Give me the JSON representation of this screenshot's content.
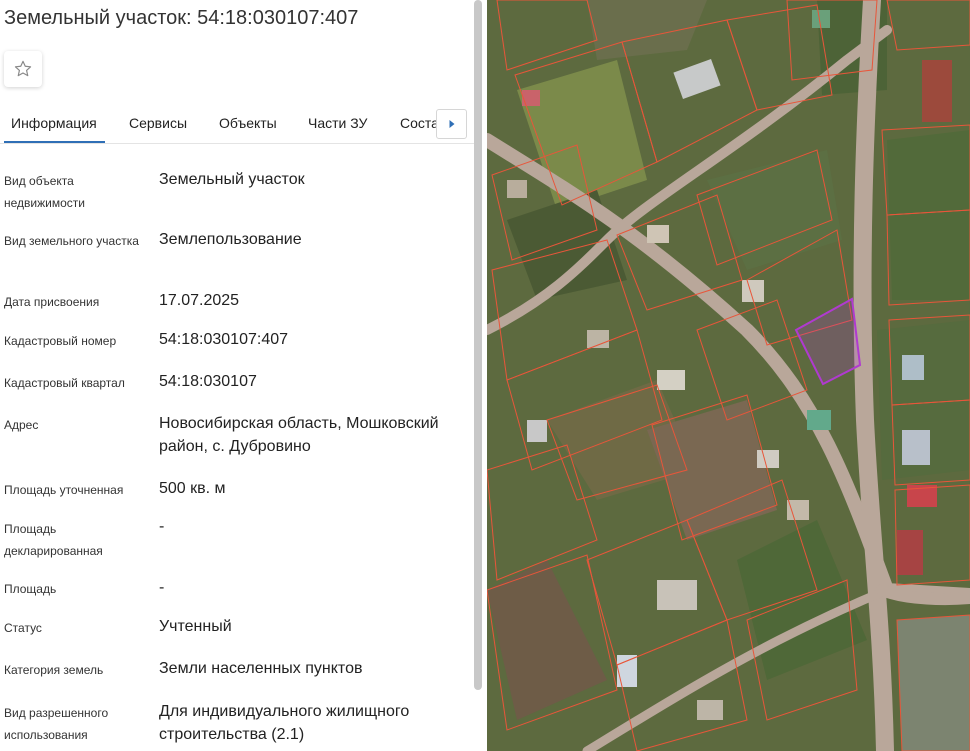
{
  "header": {
    "title": "Земельный участок: 54:18:030107:407"
  },
  "tabs": [
    {
      "label": "Информация"
    },
    {
      "label": "Сервисы"
    },
    {
      "label": "Объекты"
    },
    {
      "label": "Части ЗУ"
    },
    {
      "label": "Соста"
    }
  ],
  "icons": {
    "favorite": "star-outline-icon",
    "tab_next": "chevron-right-icon"
  },
  "info": [
    {
      "label": "Вид объекта недвижимости",
      "value": "Земельный участок"
    },
    {
      "label": "Вид земельного участка",
      "value": "Землепользование"
    },
    {
      "label": "Дата присвоения",
      "value": "17.07.2025"
    },
    {
      "label": "Кадастровый номер",
      "value": "54:18:030107:407"
    },
    {
      "label": "Кадастровый квартал",
      "value": "54:18:030107"
    },
    {
      "label": "Адрес",
      "value": "Новосибирская область, Мошковский район, с. Дубровино"
    },
    {
      "label": "Площадь уточненная",
      "value": "500 кв. м"
    },
    {
      "label": "Площадь декларированная",
      "value": "-"
    },
    {
      "label": "Площадь",
      "value": "-"
    },
    {
      "label": "Статус",
      "value": "Учтенный"
    },
    {
      "label": "Категория земель",
      "value": "Земли населенных пунктов"
    },
    {
      "label": "Вид разрешенного использования",
      "value": "Для индивидуального жилищного строительства (2.1)"
    }
  ],
  "colors": {
    "accent": "#2f6fb6",
    "parcel_border": "#e8563a",
    "selected_parcel": "#b03ad0",
    "road": "#b9a79a"
  }
}
